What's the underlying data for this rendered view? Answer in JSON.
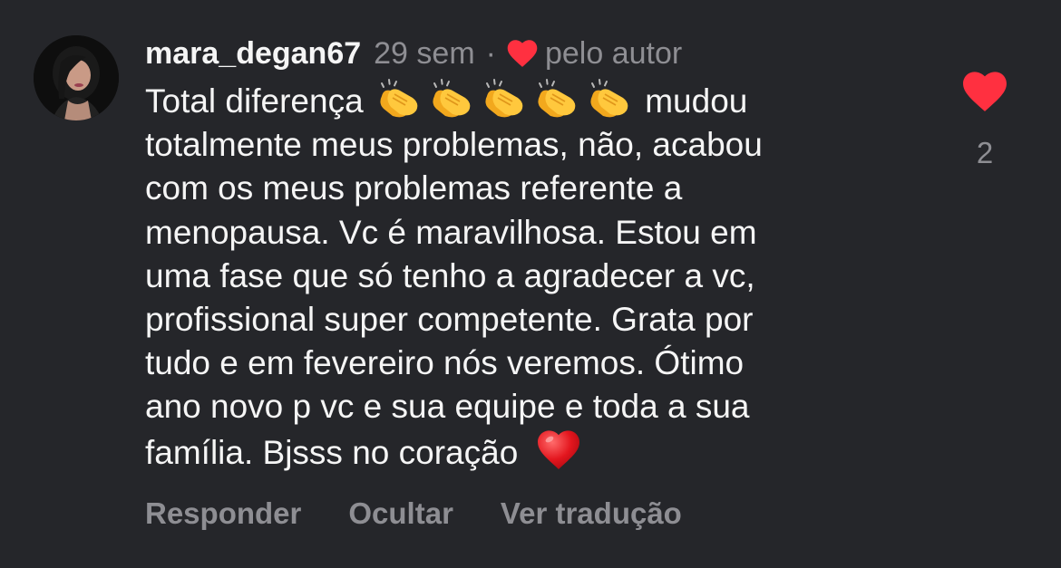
{
  "comment": {
    "username": "mara_degan67",
    "time": "29 sem",
    "separator": "·",
    "liked_by_author_icon": "heart-icon",
    "liked_by_author_label": "pelo autor",
    "text_before": "Total diferença",
    "clap_emoji_icon": "clapping-hands-emoji",
    "clap_count": 5,
    "text_after": " mudou\ntotalmente meus problemas, não, acabou\ncom os meus problemas referente a\nmenopausa. Vc é maravilhosa. Estou em\numa fase que só tenho a agradecer a vc,\nprofissional super competente. Grata por\ntudo e em fevereiro nós veremos. Ótimo\nano novo p vc e sua equipe e toda a sua\nfamília. Bjsss no coração",
    "ending_emoji_icon": "red-heart-emoji"
  },
  "actions": {
    "reply": "Responder",
    "hide": "Ocultar",
    "translate": "Ver tradução"
  },
  "like": {
    "icon": "heart-filled-icon",
    "count": "2"
  },
  "colors": {
    "background": "#25262a",
    "text_primary": "#f5f5f5",
    "text_secondary": "#8e8e93",
    "heart_red": "#ff3040"
  }
}
